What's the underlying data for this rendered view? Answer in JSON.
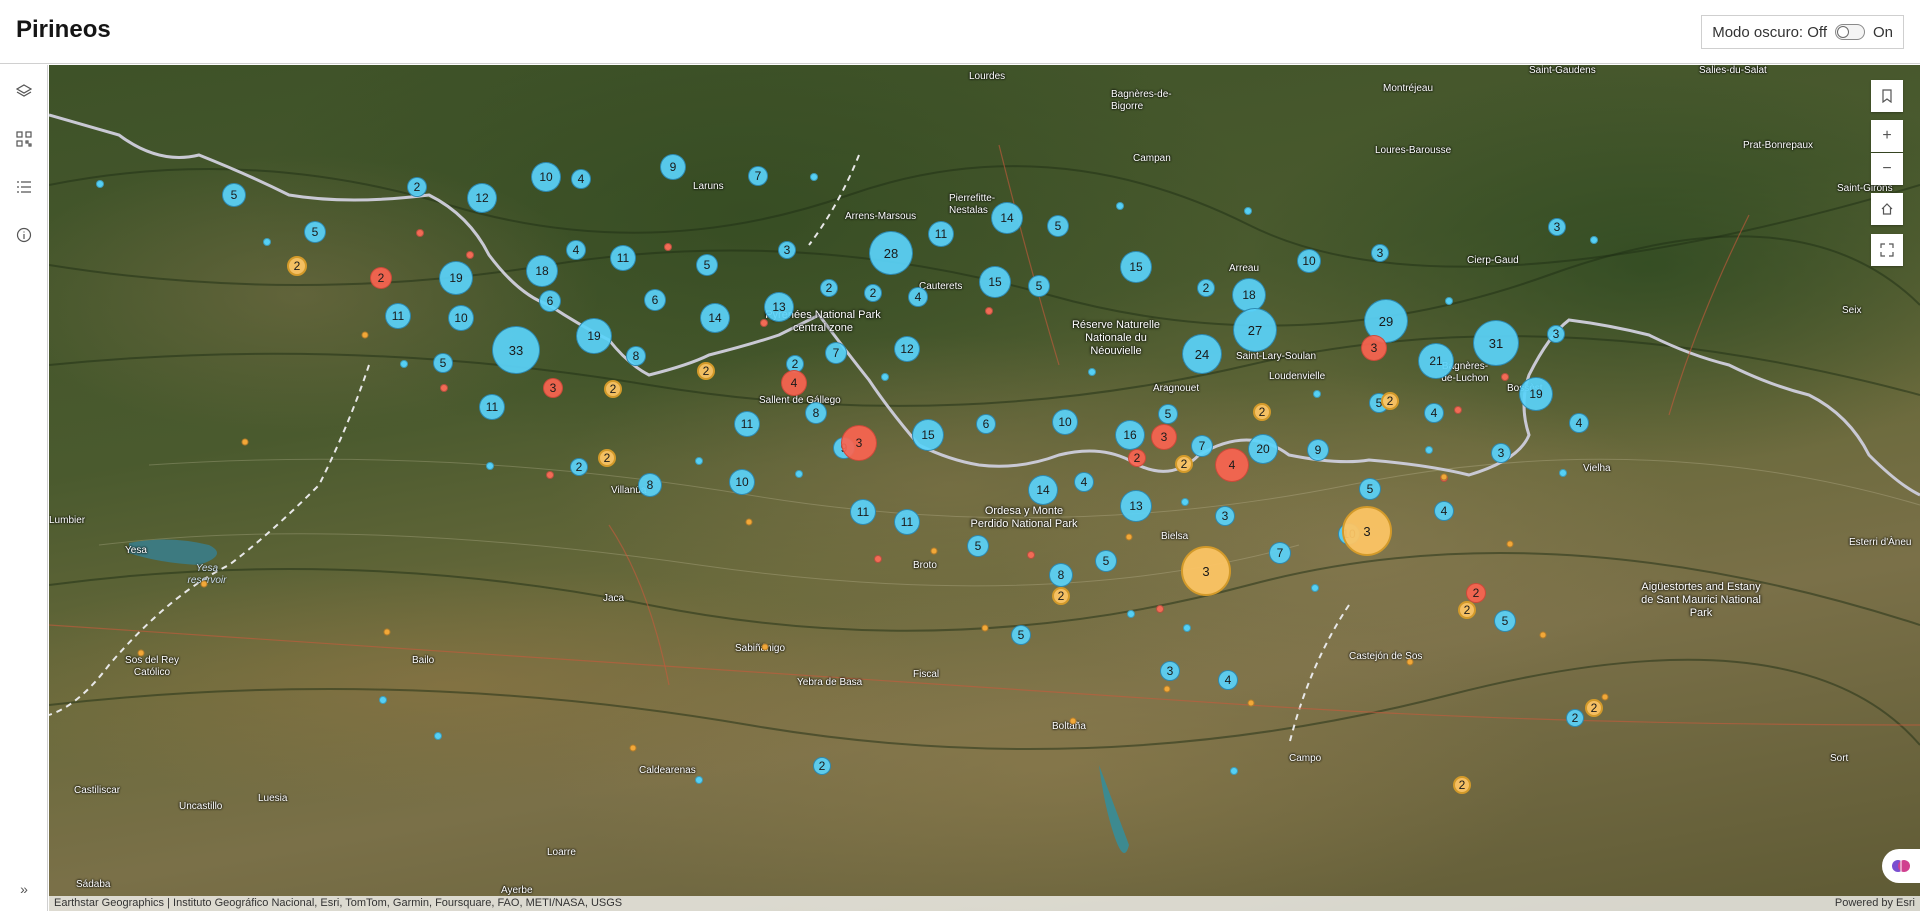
{
  "app": {
    "title": "Pirineos",
    "dark_mode_label": "Modo oscuro: Off",
    "dark_mode_on": "On"
  },
  "sidebar": {
    "items": [
      {
        "name": "layers",
        "icon": "layers-icon"
      },
      {
        "name": "legend",
        "icon": "legend-grid-icon"
      },
      {
        "name": "list",
        "icon": "list-icon"
      },
      {
        "name": "info",
        "icon": "info-icon"
      }
    ],
    "expand_icon": "double-chevron-right-icon"
  },
  "map_controls": {
    "bookmark": "bookmark-icon",
    "zoom_in": "+",
    "zoom_out": "−",
    "home": "home-icon",
    "fullscreen": "fullscreen-icon"
  },
  "places": [
    "Lourdes",
    "Bagnères-de-Bigorre",
    "Montréjeau",
    "Saint-Gaudens",
    "Salies-du-Salat",
    "Campan",
    "Loures-Barousse",
    "Prat-Bonrepaux",
    "Laruns",
    "Arrens-Marsous",
    "Pierrefitte-Nestalas",
    "Saint-Girons",
    "Cierp-Gaud",
    "Arreau",
    "Cauterets",
    "Seix",
    "Saint-Lary-Soulan",
    "Loudenvielle",
    "Bagnères-de-Luchon",
    "Bossòst",
    "Sallent de Gállego",
    "Aragnouet",
    "Vielha",
    "Villanúa",
    "Lumbier",
    "Bielsa",
    "Yesa",
    "Broto",
    "Esterri d'Àneu",
    "Jaca",
    "Castejón de Sos",
    "Sos del Rey Católico",
    "Bailo",
    "Sabiñánigo",
    "Yebra de Basa",
    "Fiscal",
    "Boltaña",
    "Campo",
    "Sort",
    "Caldearenas",
    "Castiliscar",
    "Uncastillo",
    "Luesia",
    "Loarre",
    "Sádaba",
    "Ayerbe"
  ],
  "parks": [
    "Pyrénées National Park central zone",
    "Réserve Naturelle Nationale du Néouvielle",
    "Ordesa y Monte Perdido National Park",
    "Aigüestortes and Estany de Sant Maurici National Park"
  ],
  "lakes": [
    "Yesa reservoir"
  ],
  "clusters": {
    "blue_counts": [
      "5",
      "2",
      "10",
      "4",
      "9",
      "7",
      "12",
      "5",
      "14",
      "5",
      "28",
      "11",
      "4",
      "11",
      "5",
      "19",
      "18",
      "6",
      "6",
      "14",
      "13",
      "2",
      "2",
      "4",
      "15",
      "5",
      "15",
      "10",
      "11",
      "33",
      "19",
      "8",
      "2",
      "7",
      "12",
      "18",
      "27",
      "29",
      "21",
      "31",
      "3",
      "10",
      "24",
      "3",
      "5",
      "11",
      "11",
      "8",
      "9",
      "15",
      "6",
      "10",
      "16",
      "5",
      "7",
      "20",
      "9",
      "5",
      "19",
      "4",
      "4",
      "3",
      "8",
      "10",
      "14",
      "4",
      "13",
      "3",
      "11",
      "11",
      "5",
      "5",
      "7",
      "8",
      "5",
      "3",
      "4",
      "5",
      "2",
      "2",
      "10",
      "4",
      "5",
      "2",
      "2",
      "3",
      "3"
    ],
    "red_counts": [
      "2",
      "3",
      "4",
      "3",
      "2",
      "4",
      "2",
      "3",
      "3"
    ],
    "yellow_counts": [
      "2",
      "2",
      "2",
      "2",
      "2",
      "2",
      "2",
      "3",
      "3",
      "2",
      "2",
      "2",
      "2"
    ]
  },
  "attribution": {
    "left": "Earthstar Geographics | Instituto Geográfico Nacional, Esri, TomTom, Garmin, Foursquare, FAO, METI/NASA, USGS",
    "right": "Powered by Esri"
  }
}
